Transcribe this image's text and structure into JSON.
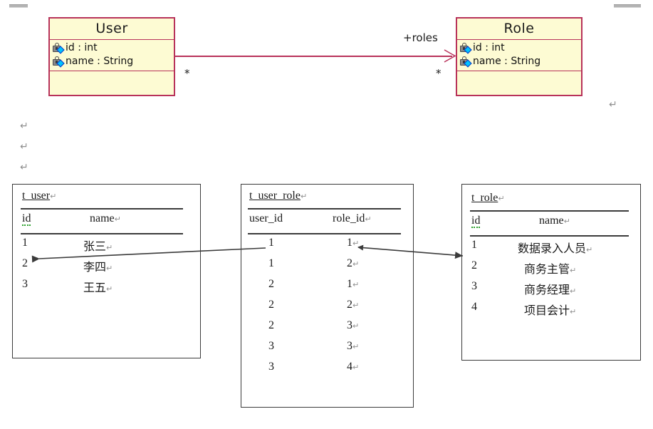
{
  "document": {
    "margin_marks": [
      "top-left",
      "top-right"
    ],
    "pilcrow_glyph": "↵"
  },
  "uml": {
    "classes": [
      {
        "name": "User",
        "attributes": [
          {
            "visibility_icon": "private-lock-icon",
            "text": "id : int"
          },
          {
            "visibility_icon": "private-lock-icon",
            "text": "name : String"
          }
        ],
        "operations": []
      },
      {
        "name": "Role",
        "attributes": [
          {
            "visibility_icon": "private-lock-icon",
            "text": "id : int"
          },
          {
            "visibility_icon": "private-lock-icon",
            "text": "name : String"
          }
        ],
        "operations": []
      }
    ],
    "association": {
      "role_label": "+roles",
      "source_multiplicity": "*",
      "target_multiplicity": "*",
      "line_color": "#b8325a",
      "direction": "User -> Role"
    }
  },
  "colors": {
    "class_fill": "#fdfbd3",
    "class_border": "#b8325a",
    "table_border": "#3b3b3b",
    "connector": "#3b3b3b",
    "pilcrow": "#8f8f8f"
  },
  "tables": [
    {
      "name": "t_user",
      "columns": [
        "id",
        "name"
      ],
      "rows": [
        [
          "1",
          "张三"
        ],
        [
          "2",
          "李四"
        ],
        [
          "3",
          "王五"
        ]
      ]
    },
    {
      "name": "t_user_role",
      "columns": [
        "user_id",
        "role_id"
      ],
      "rows": [
        [
          "1",
          "1"
        ],
        [
          "1",
          "2"
        ],
        [
          "2",
          "1"
        ],
        [
          "2",
          "2"
        ],
        [
          "2",
          "3"
        ],
        [
          "3",
          "3"
        ],
        [
          "3",
          "4"
        ]
      ]
    },
    {
      "name": "t_role",
      "columns": [
        "id",
        "name"
      ],
      "rows": [
        [
          "1",
          "数据录入人员"
        ],
        [
          "2",
          "商务主管"
        ],
        [
          "3",
          "商务经理"
        ],
        [
          "4",
          "项目会计"
        ]
      ]
    }
  ],
  "connectors": [
    {
      "name": "user-id-fk",
      "from": "t_user_role.user_id=1",
      "to": "t_user.id=1",
      "arrow": "end"
    },
    {
      "name": "role-id-fk",
      "from": "t_user_role.role_id=1",
      "to": "t_role.id=1",
      "arrow": "both"
    }
  ]
}
